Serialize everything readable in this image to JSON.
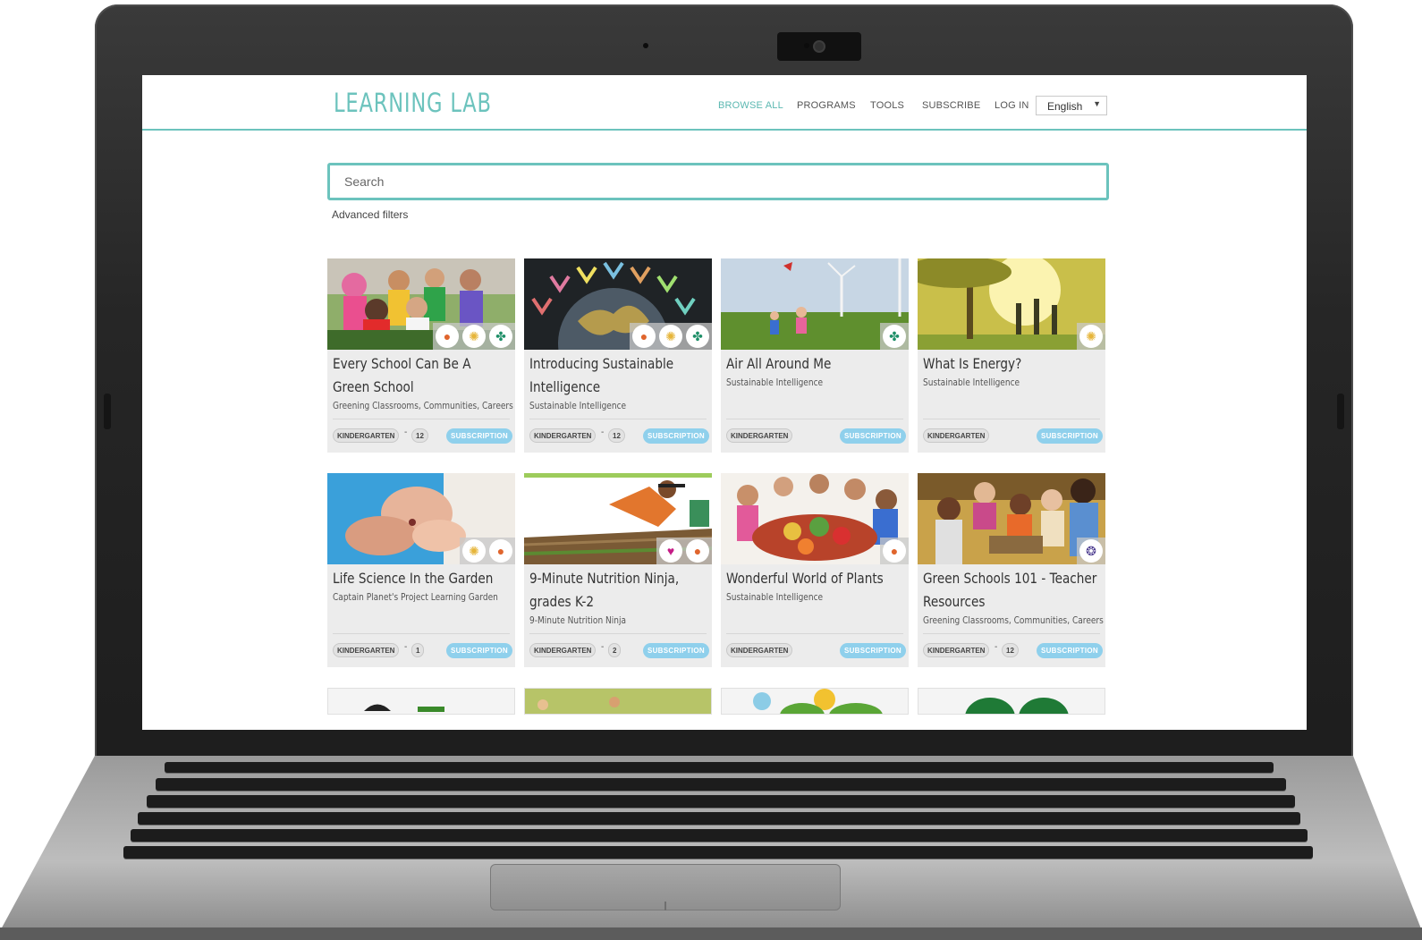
{
  "site": {
    "logo": "LEARNING LAB",
    "nav": [
      "BROWSE ALL",
      "PROGRAMS",
      "TOOLS",
      "SUBSCRIBE",
      "LOG IN"
    ],
    "active_nav": "BROWSE ALL",
    "language": "English",
    "accent_color": "#6cc3bd"
  },
  "search": {
    "placeholder": "Search",
    "advanced_filters": "Advanced filters"
  },
  "cards": [
    {
      "title": "Every School Can Be A Green School",
      "subtitle": "Greening Classrooms, Communities, Careers",
      "grade_from": "KINDERGARTEN",
      "grade_to": "12",
      "badge": "SUBSCRIPTION",
      "icons": [
        "apple-icon",
        "lightbulb-icon",
        "fan-icon"
      ]
    },
    {
      "title": "Introducing Sustainable Intelligence",
      "subtitle": "Sustainable Intelligence",
      "grade_from": "KINDERGARTEN",
      "grade_to": "12",
      "badge": "SUBSCRIPTION",
      "icons": [
        "apple-icon",
        "lightbulb-icon",
        "fan-icon"
      ]
    },
    {
      "title": "Air All Around Me",
      "subtitle": "Sustainable Intelligence",
      "grade_from": "KINDERGARTEN",
      "grade_to": "",
      "badge": "SUBSCRIPTION",
      "icons": [
        "fan-icon"
      ]
    },
    {
      "title": "What Is Energy?",
      "subtitle": "Sustainable Intelligence",
      "grade_from": "KINDERGARTEN",
      "grade_to": "",
      "badge": "SUBSCRIPTION",
      "icons": [
        "lightbulb-icon"
      ]
    },
    {
      "title": "Life Science In the Garden",
      "subtitle": "Captain Planet's Project Learning Garden",
      "grade_from": "KINDERGARTEN",
      "grade_to": "1",
      "badge": "SUBSCRIPTION",
      "icons": [
        "lightbulb-icon",
        "apple-icon"
      ]
    },
    {
      "title": "9-Minute Nutrition Ninja, grades K-2",
      "subtitle": "9-Minute Nutrition Ninja",
      "grade_from": "KINDERGARTEN",
      "grade_to": "2",
      "badge": "SUBSCRIPTION",
      "icons": [
        "heart-icon",
        "apple-icon"
      ]
    },
    {
      "title": "Wonderful World of Plants",
      "subtitle": "Sustainable Intelligence",
      "grade_from": "KINDERGARTEN",
      "grade_to": "",
      "badge": "SUBSCRIPTION",
      "icons": [
        "apple-icon"
      ]
    },
    {
      "title": "Green Schools 101 - Teacher Resources",
      "subtitle": "Greening Classrooms, Communities, Careers",
      "grade_from": "KINDERGARTEN",
      "grade_to": "12",
      "badge": "SUBSCRIPTION",
      "icons": [
        "brain-icon"
      ]
    }
  ]
}
